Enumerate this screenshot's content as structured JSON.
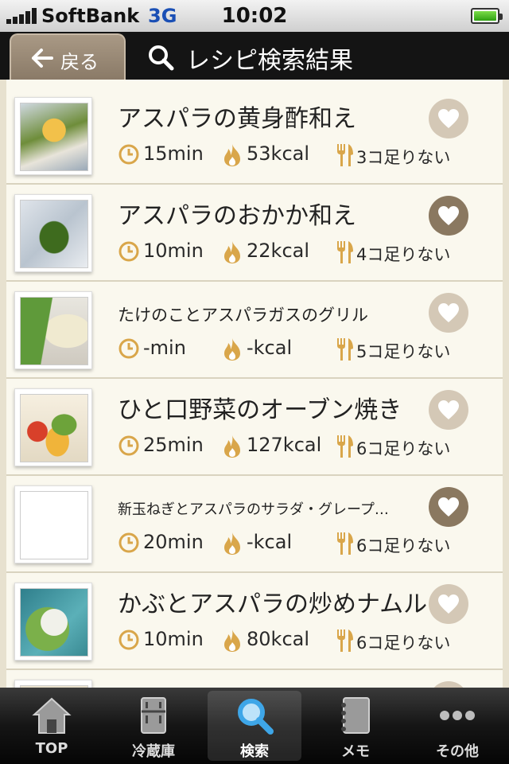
{
  "status_bar": {
    "carrier": "SoftBank",
    "network": "3G",
    "time": "10:02"
  },
  "nav": {
    "back_label": "戻る",
    "title": "レシピ検索結果"
  },
  "recipes": [
    {
      "title": "アスパラの黄身酢和え",
      "time": "15min",
      "kcal": "53kcal",
      "missing": "3コ足りない",
      "favorite": false
    },
    {
      "title": "アスパラのおかか和え",
      "time": "10min",
      "kcal": "22kcal",
      "missing": "4コ足りない",
      "favorite": true
    },
    {
      "title": "たけのことアスパラガスのグリル",
      "time": "-min",
      "kcal": "-kcal",
      "missing": "5コ足りない",
      "favorite": false
    },
    {
      "title": "ひと口野菜のオーブン焼き",
      "time": "25min",
      "kcal": "127kcal",
      "missing": "6コ足りない",
      "favorite": false
    },
    {
      "title": "新玉ねぎとアスパラのサラダ・グレープ…",
      "time": "20min",
      "kcal": "-kcal",
      "missing": "6コ足りない",
      "favorite": true
    },
    {
      "title": "かぶとアスパラの炒めナムル",
      "time": "10min",
      "kcal": "80kcal",
      "missing": "6コ足りない",
      "favorite": false
    }
  ],
  "tabs": [
    {
      "label": "TOP",
      "icon": "house-icon"
    },
    {
      "label": "冷蔵庫",
      "icon": "fridge-icon"
    },
    {
      "label": "検索",
      "icon": "search-icon"
    },
    {
      "label": "メモ",
      "icon": "notebook-icon"
    },
    {
      "label": "その他",
      "icon": "more-icon"
    }
  ],
  "colors": {
    "accent": "#d9a64a",
    "list_background": "#faf8ee",
    "heart_off": "#d4c8b6",
    "heart_on": "#8a7860"
  }
}
